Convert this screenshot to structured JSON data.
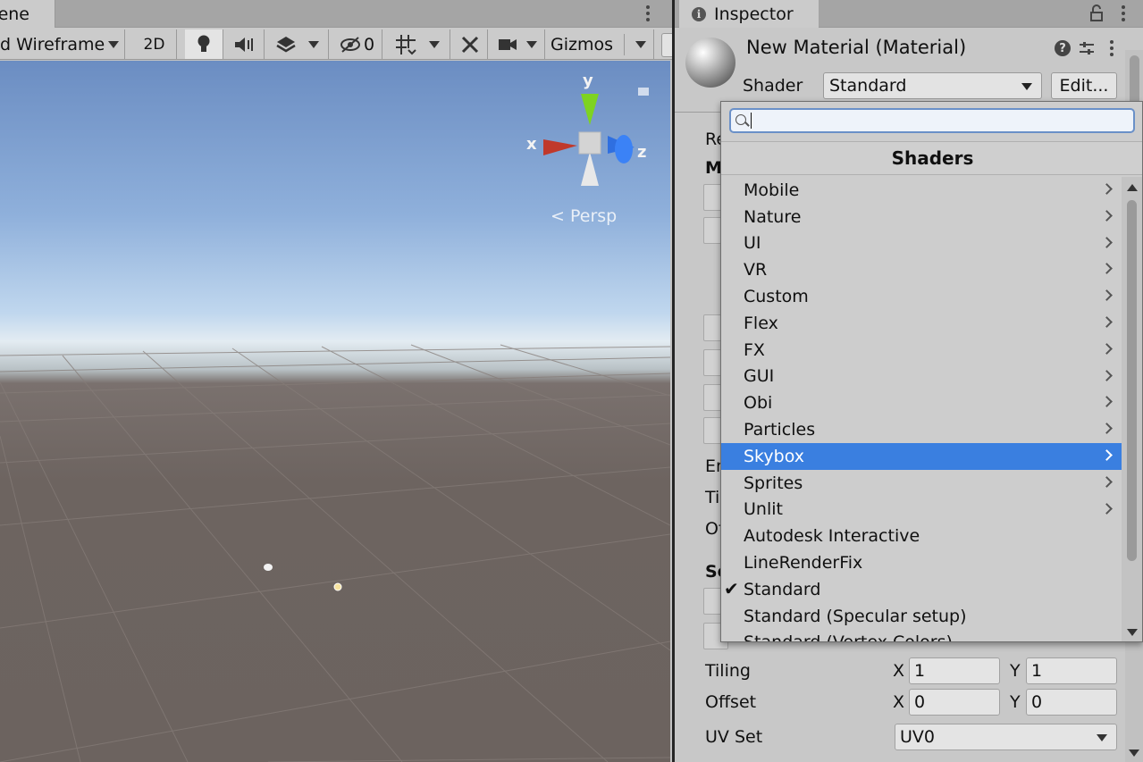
{
  "scene": {
    "tab_label": "ene",
    "toolbar": {
      "draw_mode": "d Wireframe",
      "mode_2d": "2D",
      "hidden_count": "0",
      "gizmos_label": "Gizmos"
    },
    "viewport": {
      "persp_label": "Persp",
      "axis_x": "x",
      "axis_y": "y",
      "axis_z": "z"
    }
  },
  "inspector": {
    "tab_label": "Inspector",
    "material_title": "New Material (Material)",
    "shader_label": "Shader",
    "shader_value": "Standard",
    "edit_button": "Edit...",
    "partial_labels": {
      "re": "Re",
      "m": "M",
      "er": "Er",
      "ti": "Ti",
      "of": "Of",
      "se": "Se"
    },
    "tiling_label": "Tiling",
    "offset_label": "Offset",
    "tiling_x": "1",
    "tiling_y": "1",
    "offset_x": "0",
    "offset_y": "0",
    "axis_x": "X",
    "axis_y": "Y",
    "uv_set_label": "UV Set",
    "uv_set_value": "UV0"
  },
  "dropdown": {
    "search_value": "",
    "header": "Shaders",
    "items": [
      {
        "label": "Mobile",
        "submenu": true
      },
      {
        "label": "Nature",
        "submenu": true
      },
      {
        "label": "UI",
        "submenu": true
      },
      {
        "label": "VR",
        "submenu": true
      },
      {
        "label": "Custom",
        "submenu": true
      },
      {
        "label": "Flex",
        "submenu": true
      },
      {
        "label": "FX",
        "submenu": true
      },
      {
        "label": "GUI",
        "submenu": true
      },
      {
        "label": "Obi",
        "submenu": true
      },
      {
        "label": "Particles",
        "submenu": true
      },
      {
        "label": "Skybox",
        "submenu": true,
        "highlighted": true
      },
      {
        "label": "Sprites",
        "submenu": true
      },
      {
        "label": "Unlit",
        "submenu": true
      },
      {
        "label": "Autodesk Interactive",
        "submenu": false
      },
      {
        "label": "LineRenderFix",
        "submenu": false
      },
      {
        "label": "Standard",
        "submenu": false,
        "checked": true
      },
      {
        "label": "Standard (Specular setup)",
        "submenu": false
      },
      {
        "label": "Standard (Vertex Colors)",
        "submenu": false
      }
    ],
    "check_glyph": "✔"
  },
  "colors": {
    "highlight": "#3a7fe0",
    "axis_x": "#c0392b",
    "axis_y": "#7ed321",
    "axis_z": "#2f6fe0"
  }
}
